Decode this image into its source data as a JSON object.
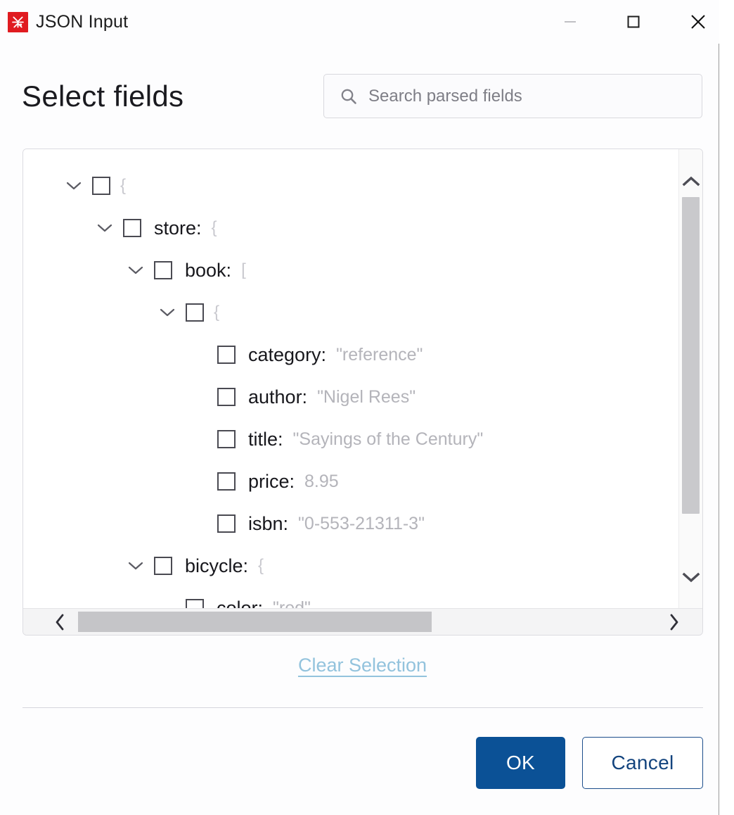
{
  "window": {
    "title": "JSON Input",
    "app_icon": "app-logo-icon",
    "controls": {
      "minimize": "minimize-icon",
      "maximize": "maximize-icon",
      "close": "close-icon"
    }
  },
  "header": {
    "page_title": "Select fields",
    "search": {
      "placeholder": "Search parsed fields",
      "value": "",
      "icon": "search-icon"
    }
  },
  "tree": {
    "rows": [
      {
        "depth": 0,
        "expandable": true,
        "expanded": true,
        "checked": false,
        "key": "",
        "value": "",
        "brace": "{"
      },
      {
        "depth": 1,
        "expandable": true,
        "expanded": true,
        "checked": false,
        "key": "store:",
        "value": "",
        "brace": "{"
      },
      {
        "depth": 2,
        "expandable": true,
        "expanded": true,
        "checked": false,
        "key": "book:",
        "value": "",
        "brace": "["
      },
      {
        "depth": 3,
        "expandable": true,
        "expanded": true,
        "checked": false,
        "key": "",
        "value": "",
        "brace": "{"
      },
      {
        "depth": 4,
        "expandable": false,
        "expanded": false,
        "checked": false,
        "key": "category:",
        "value": "\"reference\"",
        "brace": ""
      },
      {
        "depth": 4,
        "expandable": false,
        "expanded": false,
        "checked": false,
        "key": "author:",
        "value": "\"Nigel Rees\"",
        "brace": ""
      },
      {
        "depth": 4,
        "expandable": false,
        "expanded": false,
        "checked": false,
        "key": "title:",
        "value": "\"Sayings of the Century\"",
        "brace": ""
      },
      {
        "depth": 4,
        "expandable": false,
        "expanded": false,
        "checked": false,
        "key": "price:",
        "value": "8.95",
        "brace": ""
      },
      {
        "depth": 4,
        "expandable": false,
        "expanded": false,
        "checked": false,
        "key": "isbn:",
        "value": "\"0-553-21311-3\"",
        "brace": ""
      },
      {
        "depth": 2,
        "expandable": true,
        "expanded": true,
        "checked": false,
        "key": "bicycle:",
        "value": "",
        "brace": "{"
      },
      {
        "depth": 3,
        "expandable": false,
        "expanded": false,
        "checked": false,
        "key": "color:",
        "value": "\"red\"",
        "brace": ""
      }
    ],
    "vertical_scrollbar": {
      "up_icon": "chevron-up-icon",
      "down_icon": "chevron-down-icon"
    },
    "horizontal_scrollbar": {
      "left_icon": "chevron-left-icon",
      "right_icon": "chevron-right-icon"
    }
  },
  "actions": {
    "clear_selection": "Clear Selection",
    "ok": "OK",
    "cancel": "Cancel"
  },
  "colors": {
    "app_icon_bg": "#e01b20",
    "primary_button": "#0b5196",
    "secondary_button_border": "#1d4e8c",
    "link": "#93c3dd",
    "value_text": "#b4b4ba",
    "scroll_thumb": "#c5c5c8"
  }
}
